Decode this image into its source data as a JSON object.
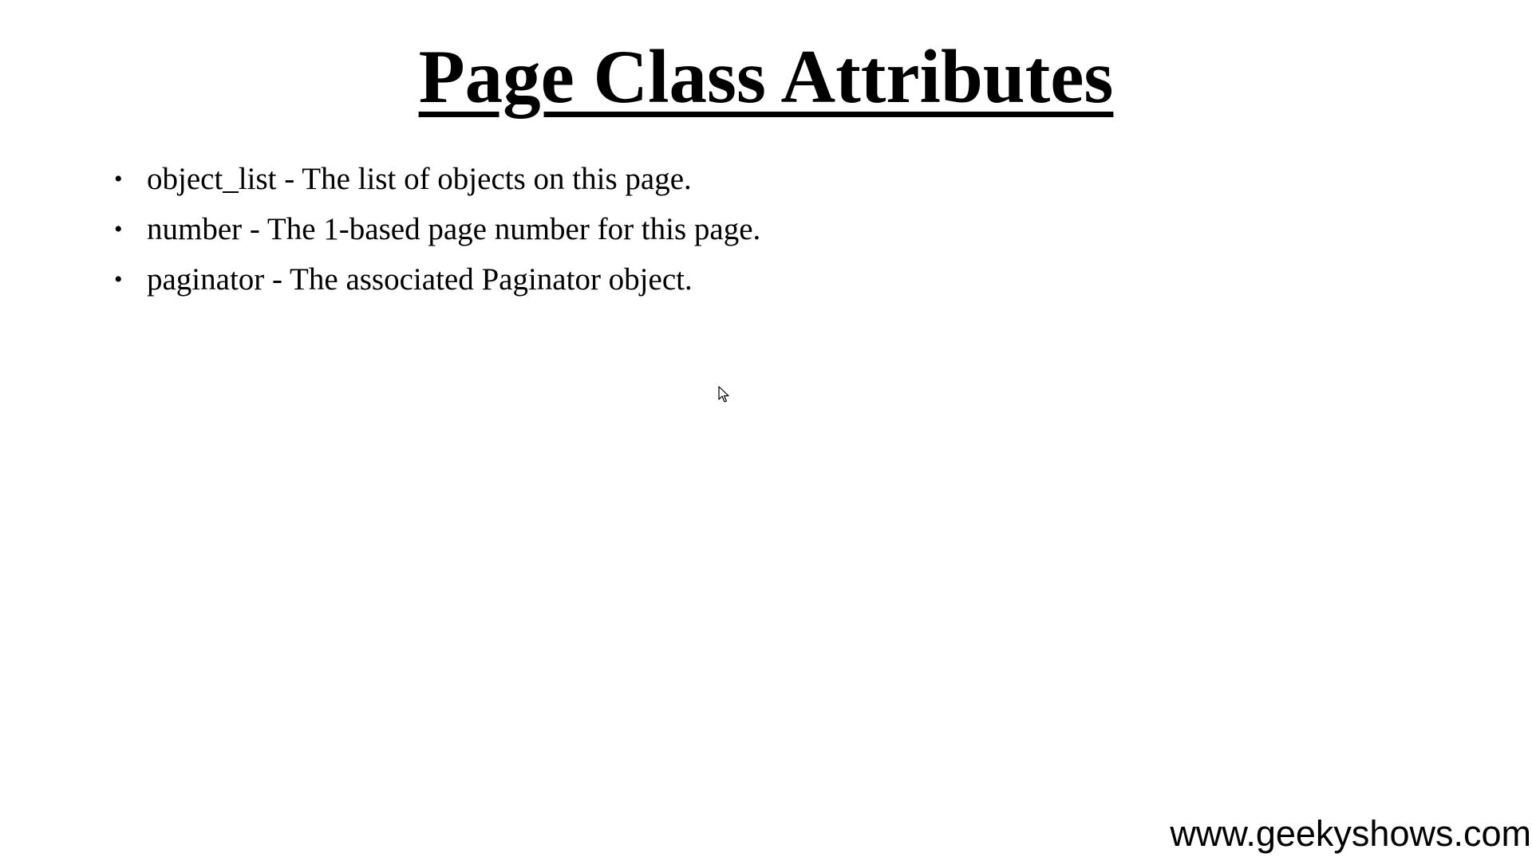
{
  "slide": {
    "title": "Page Class Attributes",
    "bullets": [
      "object_list - The list of objects on this page.",
      "number - The 1-based page number for this page.",
      "paginator - The associated Paginator object."
    ],
    "watermark": "www.geekyshows.com"
  },
  "icons": {
    "bullet": "bullet-dot",
    "cursor": "mouse-pointer-icon"
  }
}
